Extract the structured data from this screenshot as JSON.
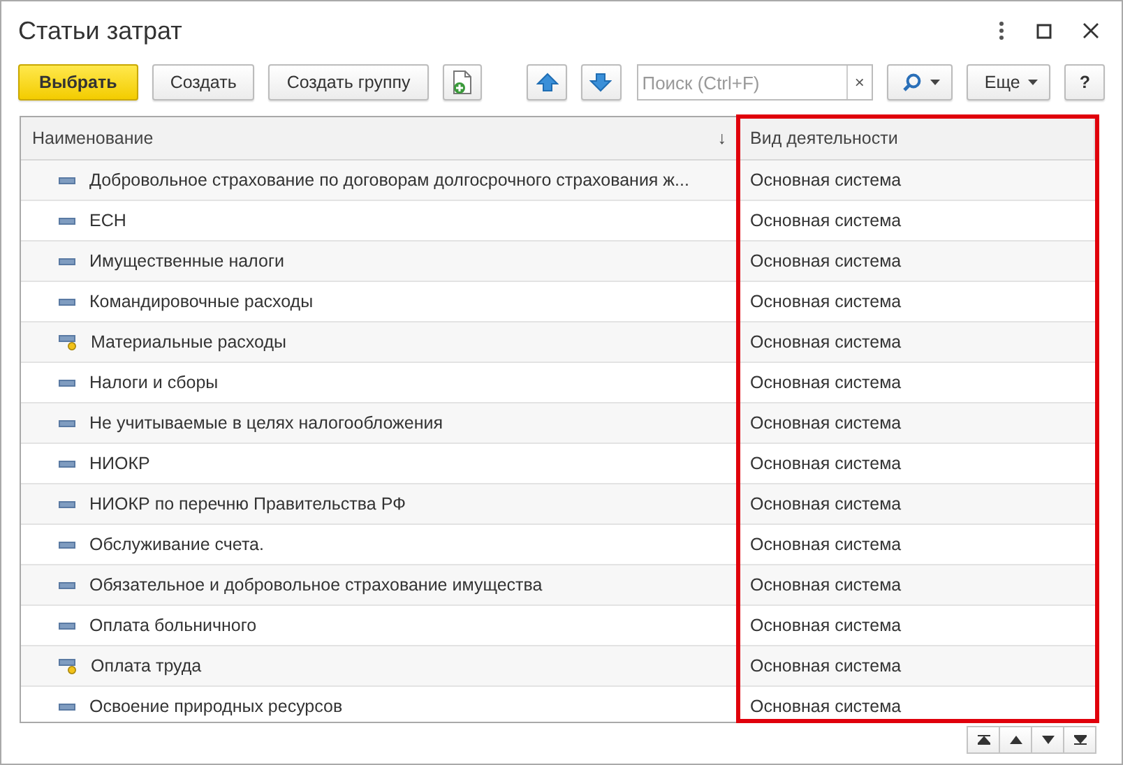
{
  "window": {
    "title": "Статьи затрат"
  },
  "toolbar": {
    "buttons": [
      {
        "kind": "primary",
        "label": "Выбрать"
      },
      {
        "kind": "plain",
        "label": "Создать"
      },
      {
        "kind": "plain",
        "label": "Создать группу"
      },
      {
        "kind": "copy-icon"
      },
      {
        "kind": "up-icon"
      },
      {
        "kind": "down-icon"
      }
    ],
    "search": {
      "placeholder": "Поиск (Ctrl+F)",
      "clear": "×"
    },
    "more": {
      "label": "Еще"
    },
    "help": {
      "label": "?"
    }
  },
  "table": {
    "columns": [
      {
        "label": "Наименование",
        "sort": "↓"
      },
      {
        "label": "Вид деятельности",
        "highlighted": true
      }
    ],
    "rows": [
      {
        "kind": "item",
        "cells": [
          "Добровольное страхование по договорам долгосрочного страхования ж...",
          "Основная система"
        ]
      },
      {
        "kind": "item",
        "cells": [
          "ЕСН",
          "Основная система"
        ]
      },
      {
        "kind": "item",
        "cells": [
          "Имущественные налоги",
          "Основная система"
        ]
      },
      {
        "kind": "item",
        "cells": [
          "Командировочные расходы",
          "Основная система"
        ]
      },
      {
        "kind": "item-marked",
        "cells": [
          "Материальные расходы",
          "Основная система"
        ]
      },
      {
        "kind": "item",
        "cells": [
          "Налоги и сборы",
          "Основная система"
        ]
      },
      {
        "kind": "item",
        "cells": [
          "Не учитываемые в целях налогообложения",
          "Основная система"
        ]
      },
      {
        "kind": "item",
        "cells": [
          "НИОКР",
          "Основная система"
        ]
      },
      {
        "kind": "item",
        "cells": [
          "НИОКР по перечню Правительства РФ",
          "Основная система"
        ]
      },
      {
        "kind": "item",
        "cells": [
          "Обслуживание счета.",
          "Основная система"
        ]
      },
      {
        "kind": "item",
        "cells": [
          "Обязательное и добровольное страхование имущества",
          "Основная система"
        ]
      },
      {
        "kind": "item",
        "cells": [
          "Оплата больничного",
          "Основная система"
        ]
      },
      {
        "kind": "item-marked",
        "cells": [
          "Оплата труда",
          "Основная система"
        ]
      },
      {
        "kind": "item",
        "cells": [
          "Освоение природных ресурсов",
          "Основная система"
        ]
      }
    ]
  }
}
